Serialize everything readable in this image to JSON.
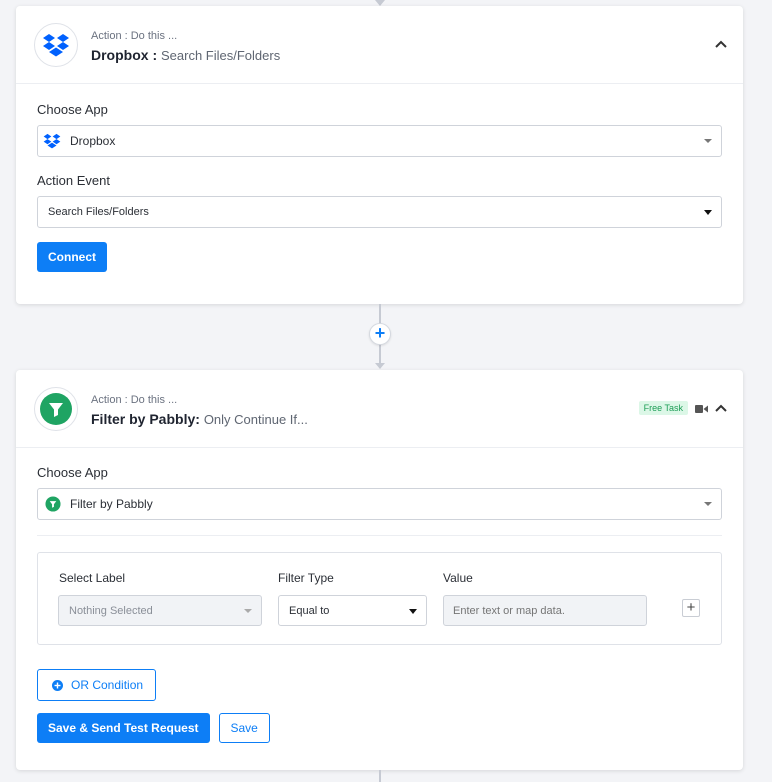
{
  "step1": {
    "kind": "Action : Do this ...",
    "app_name": "Dropbox :",
    "event_subtitle": "Search Files/Folders",
    "choose_app_label": "Choose App",
    "choose_app_value": "Dropbox",
    "action_event_label": "Action Event",
    "action_event_value": "Search Files/Folders",
    "connect_label": "Connect",
    "icon": "dropbox-icon"
  },
  "add_step_label": "+",
  "step2": {
    "kind": "Action : Do this ...",
    "app_name": "Filter by Pabbly:",
    "event_subtitle": "Only Continue If...",
    "badge": "Free Task",
    "choose_app_label": "Choose App",
    "choose_app_value": "Filter by Pabbly",
    "filter": {
      "select_label_header": "Select Label",
      "select_label_value": "Nothing Selected",
      "filter_type_header": "Filter Type",
      "filter_type_value": "Equal to",
      "value_header": "Value",
      "value_placeholder": "Enter text or map data.",
      "add_label": "+"
    },
    "or_condition_label": "OR Condition",
    "save_send_label": "Save & Send Test Request",
    "save_label": "Save",
    "icon": "filter-icon"
  },
  "colors": {
    "primary": "#0d7ef6",
    "dropbox": "#0061fe",
    "filter_green": "#1fa463",
    "badge_bg": "#dcf7e7"
  }
}
